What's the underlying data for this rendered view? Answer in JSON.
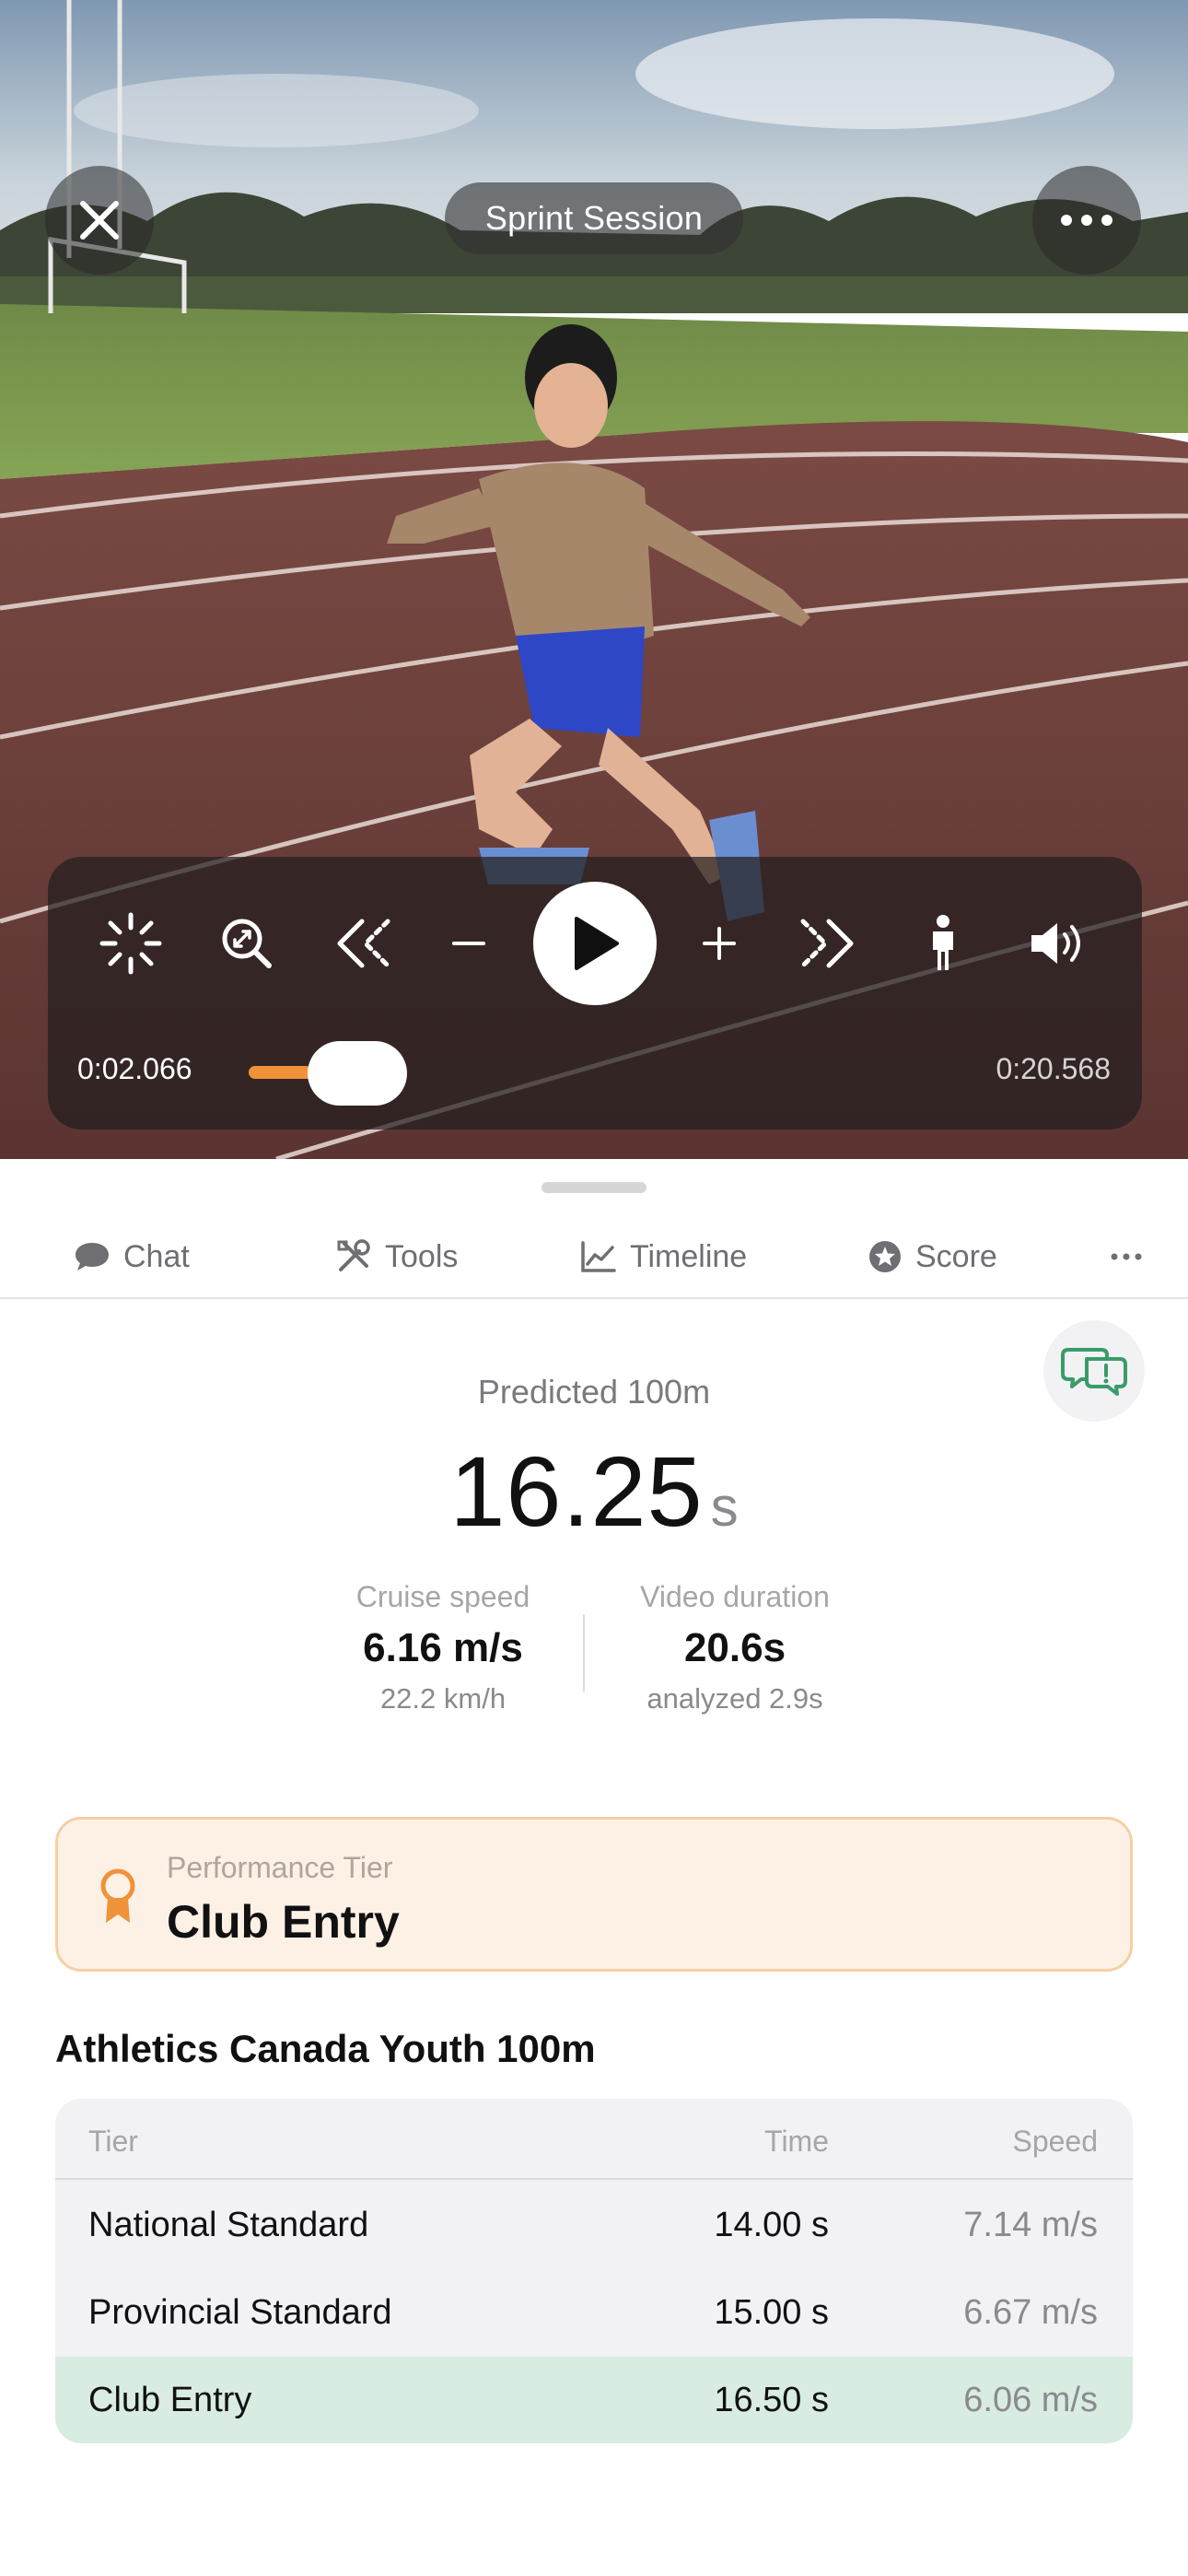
{
  "header": {
    "session_title": "Sprint Session"
  },
  "player": {
    "current_time": "0:02.066",
    "total_time": "0:20.568",
    "progress": 0.1,
    "controls": [
      "loading-spinner-icon",
      "zoom-icon",
      "rewind-icon",
      "minus-icon",
      "play-icon",
      "plus-icon",
      "forward-icon",
      "person-icon",
      "volume-icon"
    ],
    "accent_color": "#f0923a"
  },
  "tabs": [
    {
      "label": "Chat",
      "icon": "chat-bubble-icon"
    },
    {
      "label": "Tools",
      "icon": "tools-icon"
    },
    {
      "label": "Timeline",
      "icon": "chart-line-icon"
    },
    {
      "label": "Score",
      "icon": "star-badge-icon"
    }
  ],
  "prediction": {
    "label": "Predicted 100m",
    "value": "16.25",
    "unit": "s"
  },
  "stats": {
    "cruise": {
      "label": "Cruise speed",
      "value": "6.16 m/s",
      "sub": "22.2 km/h"
    },
    "duration": {
      "label": "Video duration",
      "value": "20.6s",
      "sub": "analyzed 2.9s"
    }
  },
  "tier": {
    "label": "Performance Tier",
    "value": "Club Entry",
    "color": "#f0923a"
  },
  "standards": {
    "title": "Athletics Canada Youth 100m",
    "headers": {
      "tier": "Tier",
      "time": "Time",
      "speed": "Speed"
    },
    "rows": [
      {
        "tier": "National Standard",
        "time": "14.00 s",
        "speed": "7.14 m/s"
      },
      {
        "tier": "Provincial Standard",
        "time": "15.00 s",
        "speed": "6.67 m/s"
      },
      {
        "tier": "Club Entry",
        "time": "16.50 s",
        "speed": "6.06 m/s"
      }
    ],
    "highlight_color": "#d8ece2"
  }
}
